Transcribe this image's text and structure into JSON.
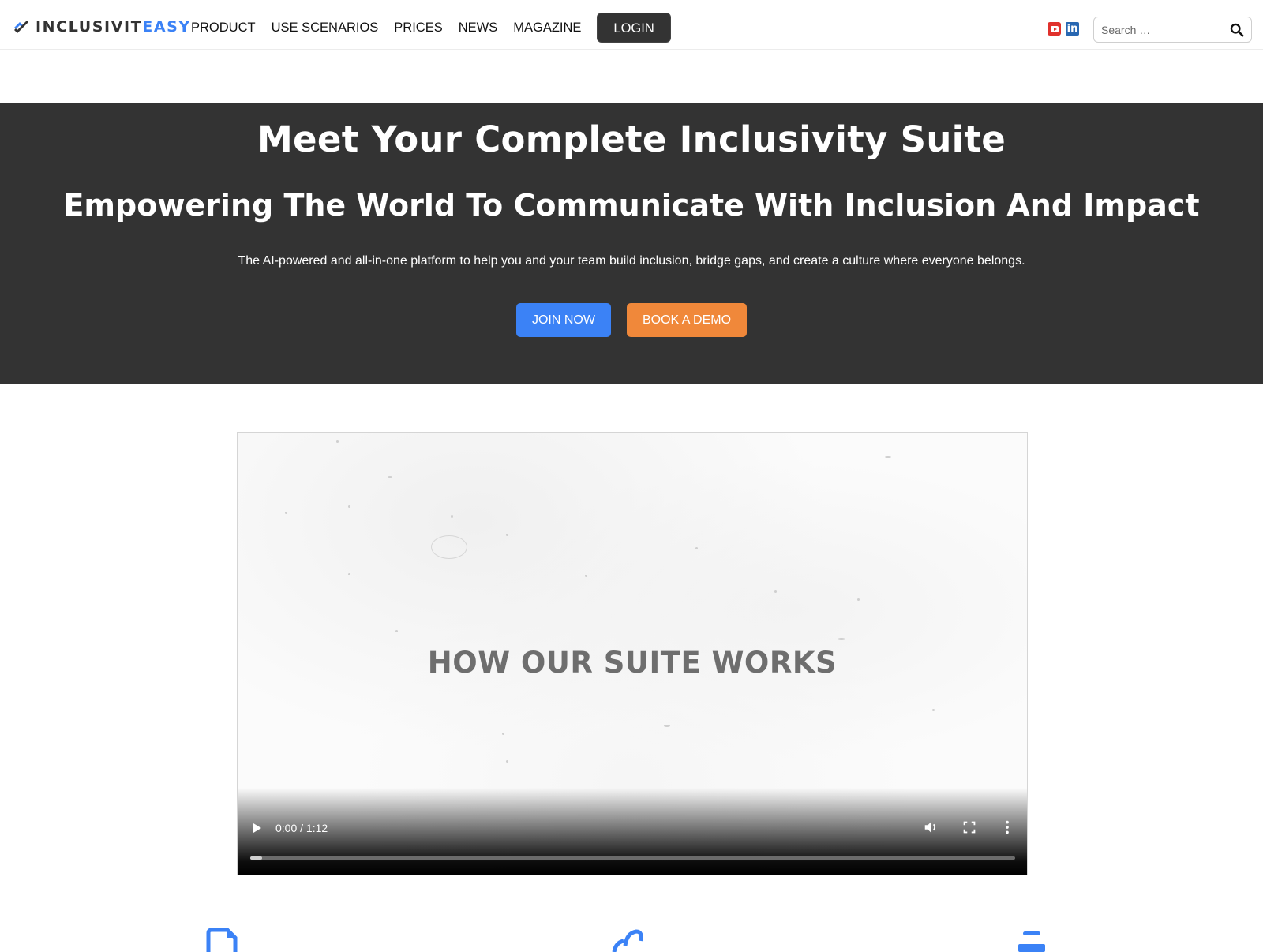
{
  "header": {
    "logo": {
      "prefix": "INCLUSIVIT",
      "accent": "EASY",
      "icon": "checkmark-logo-icon"
    },
    "nav": [
      {
        "label": "PRODUCT"
      },
      {
        "label": "USE SCENARIOS"
      },
      {
        "label": "PRICES"
      },
      {
        "label": "NEWS"
      },
      {
        "label": "MAGAZINE"
      }
    ],
    "login_label": "LOGIN",
    "social": [
      {
        "name": "youtube-icon",
        "color": "#e0312c"
      },
      {
        "name": "linkedin-icon",
        "label": "in",
        "color": "#2867b2"
      }
    ],
    "search": {
      "placeholder": "Search …",
      "value": ""
    }
  },
  "hero": {
    "title": "Meet Your Complete Inclusivity Suite",
    "subtitle": "Empowering The World To Communicate With Inclusion And Impact",
    "description": "The AI-powered and all-in-one platform to help you and your team build inclusion, bridge gaps, and create a culture where everyone belongs.",
    "join_label": "JOIN NOW",
    "demo_label": "BOOK A DEMO",
    "colors": {
      "background": "#333333",
      "join": "#3b82f6",
      "demo": "#f0883a"
    }
  },
  "video": {
    "overlay_title": "HOW OUR SUITE WORKS",
    "current_time": "0:00",
    "duration": "1:12",
    "time_display": "0:00 / 1:12",
    "progress_fraction": 0.015
  },
  "features": {
    "icons": [
      "document-icon",
      "link-icon",
      "list-icon"
    ],
    "accent": "#3b82f6"
  }
}
